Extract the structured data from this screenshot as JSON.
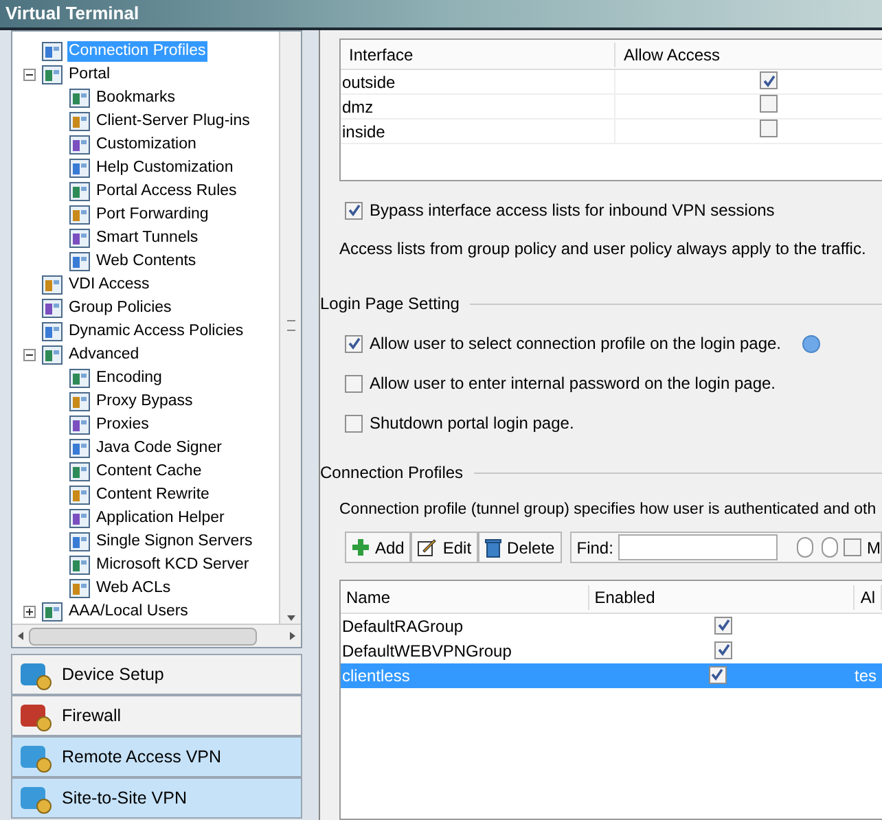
{
  "window": {
    "title": "Virtual Terminal"
  },
  "tree": [
    {
      "children": [
        {
          "label": "Connection Profiles",
          "selected": true
        },
        {
          "label": "Portal",
          "expanded": true,
          "selected": false,
          "children": [
            {
              "label": "Bookmarks",
              "selected": false
            },
            {
              "label": "Client-Server Plug-ins",
              "selected": false
            },
            {
              "label": "Customization",
              "selected": false
            },
            {
              "label": "Help Customization",
              "selected": false
            },
            {
              "label": "Portal Access Rules",
              "selected": false
            },
            {
              "label": "Port Forwarding",
              "selected": false
            },
            {
              "label": "Smart Tunnels",
              "selected": false
            },
            {
              "label": "Web Contents",
              "selected": false
            }
          ]
        },
        {
          "label": "VDI Access",
          "selected": false
        },
        {
          "label": "Group Policies",
          "selected": false
        },
        {
          "label": "Dynamic Access Policies",
          "selected": false
        },
        {
          "label": "Advanced",
          "expanded": true,
          "selected": false,
          "children": [
            {
              "label": "Encoding",
              "selected": false
            },
            {
              "label": "Proxy Bypass",
              "selected": false
            },
            {
              "label": "Proxies",
              "selected": false
            },
            {
              "label": "Java Code Signer",
              "selected": false
            },
            {
              "label": "Content Cache",
              "selected": false
            },
            {
              "label": "Content Rewrite",
              "selected": false
            },
            {
              "label": "Application Helper",
              "selected": false
            },
            {
              "label": "Single Signon Servers",
              "selected": false
            },
            {
              "label": "Microsoft KCD Server",
              "selected": false
            },
            {
              "label": "Web ACLs",
              "selected": false
            }
          ]
        }
      ]
    },
    {
      "label": "AAA/Local Users",
      "expanded": false,
      "selected": false
    }
  ],
  "nav": [
    {
      "label": "Device Setup",
      "selected": false
    },
    {
      "label": "Firewall",
      "selected": false
    },
    {
      "label": "Remote Access VPN",
      "selected": true
    },
    {
      "label": "Site-to-Site VPN",
      "selected": true
    }
  ],
  "interfaces": {
    "columns": [
      "Interface",
      "Allow Access"
    ],
    "rows": [
      {
        "name": "outside",
        "checked": true
      },
      {
        "name": "dmz",
        "checked": false
      },
      {
        "name": "inside",
        "checked": false
      }
    ]
  },
  "bypass": {
    "label": "Bypass interface access lists for inbound VPN sessions",
    "checked": true
  },
  "note": "Access lists from group policy and user policy always apply to the traffic.",
  "login_page": {
    "title": "Login Page Setting",
    "options": [
      {
        "label": "Allow user to select connection profile on the login page.",
        "checked": true,
        "info": true
      },
      {
        "label": "Allow user to enter internal password on the login page.",
        "checked": false,
        "info": false
      },
      {
        "label": "Shutdown portal login page.",
        "checked": false,
        "info": false
      }
    ]
  },
  "profiles": {
    "title": "Connection Profiles",
    "description": "Connection profile (tunnel group) specifies how user is authenticated and oth",
    "toolbar": [
      {
        "kind": "add",
        "label": "Add"
      },
      {
        "kind": "edit",
        "label": "Edit"
      },
      {
        "kind": "delete",
        "label": "Delete"
      }
    ],
    "find": {
      "label": "Find:"
    },
    "match": {
      "label": "M",
      "checked": false
    },
    "columns": [
      "Name",
      "Enabled",
      "Al"
    ],
    "rows": [
      {
        "name": "DefaultRAGroup",
        "enabled": true,
        "selected": false
      },
      {
        "name": "DefaultWEBVPNGroup",
        "enabled": true,
        "selected": false
      },
      {
        "name": "clientless",
        "enabled": true,
        "selected": true,
        "column_3": "tes"
      }
    ]
  }
}
